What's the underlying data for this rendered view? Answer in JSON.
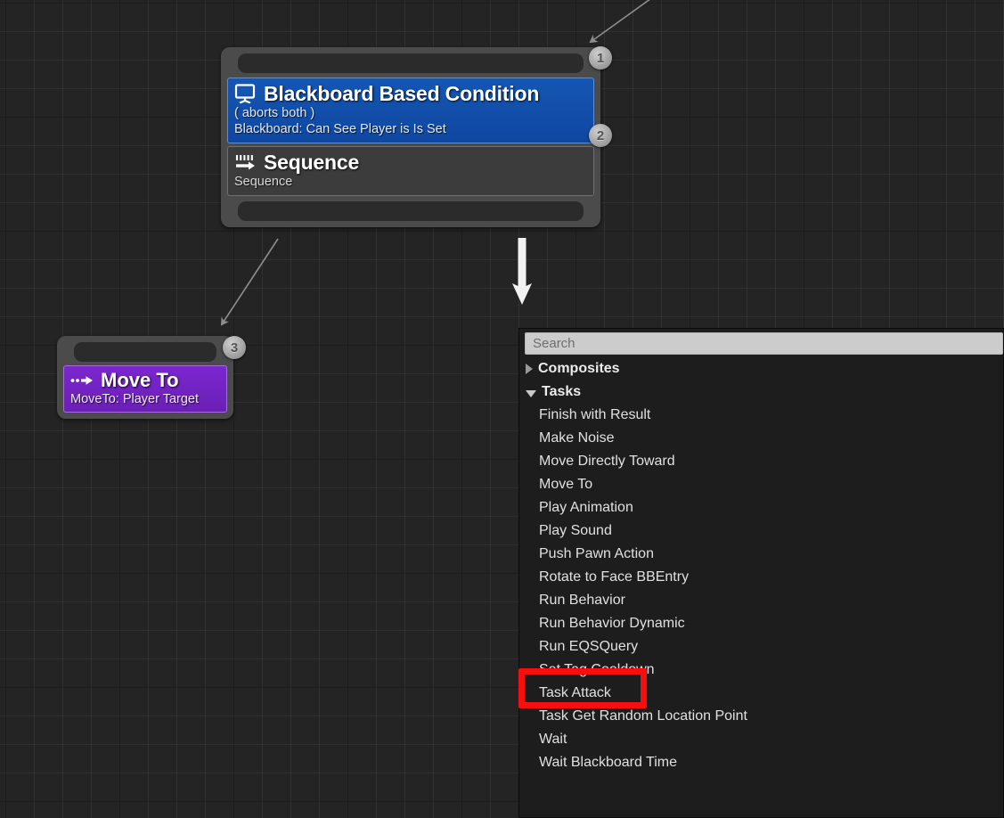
{
  "graph": {
    "nodes": [
      {
        "id": "root-composite",
        "badges": [
          "1",
          "2"
        ],
        "decorator": {
          "icon": "blackboard-icon",
          "title": "Blackboard Based Condition",
          "sub_line_1": "( aborts both )",
          "sub_line_2": "Blackboard: Can See Player is Is Set",
          "color": "#1556b4"
        },
        "composite": {
          "icon": "sequence-icon",
          "title": "Sequence",
          "sub_line_1": "Sequence",
          "color": "#3c3c3c"
        }
      },
      {
        "id": "move-to-task",
        "badges": [
          "3"
        ],
        "task": {
          "icon": "move-to-arrow-icon",
          "title": "Move To",
          "sub_line_1": "MoveTo: Player Target",
          "color": "#7b27cf"
        }
      }
    ],
    "connectors": [
      {
        "name": "incoming-parent-wire",
        "style": "thin-gray-arrow"
      },
      {
        "name": "sequence-to-move-to-wire",
        "style": "thin-gray-arrow"
      },
      {
        "name": "new-node-drag-arrow",
        "style": "white-arrow"
      }
    ]
  },
  "palette": {
    "search": {
      "placeholder": "Search",
      "value": ""
    },
    "groups": [
      {
        "label": "Composites",
        "expanded": false,
        "items": []
      },
      {
        "label": "Tasks",
        "expanded": true,
        "items": [
          "Finish with Result",
          "Make Noise",
          "Move Directly Toward",
          "Move To",
          "Play Animation",
          "Play Sound",
          "Push Pawn Action",
          "Rotate to Face BBEntry",
          "Run Behavior",
          "Run Behavior Dynamic",
          "Run EQSQuery",
          "Set Tag Cooldown",
          "Task Attack",
          "Task Get Random Location Point",
          "Wait",
          "Wait Blackboard Time"
        ]
      }
    ]
  },
  "annotation": {
    "name": "task-attack-highlight",
    "target_label": "Task Attack",
    "color": "#f50f0f"
  }
}
